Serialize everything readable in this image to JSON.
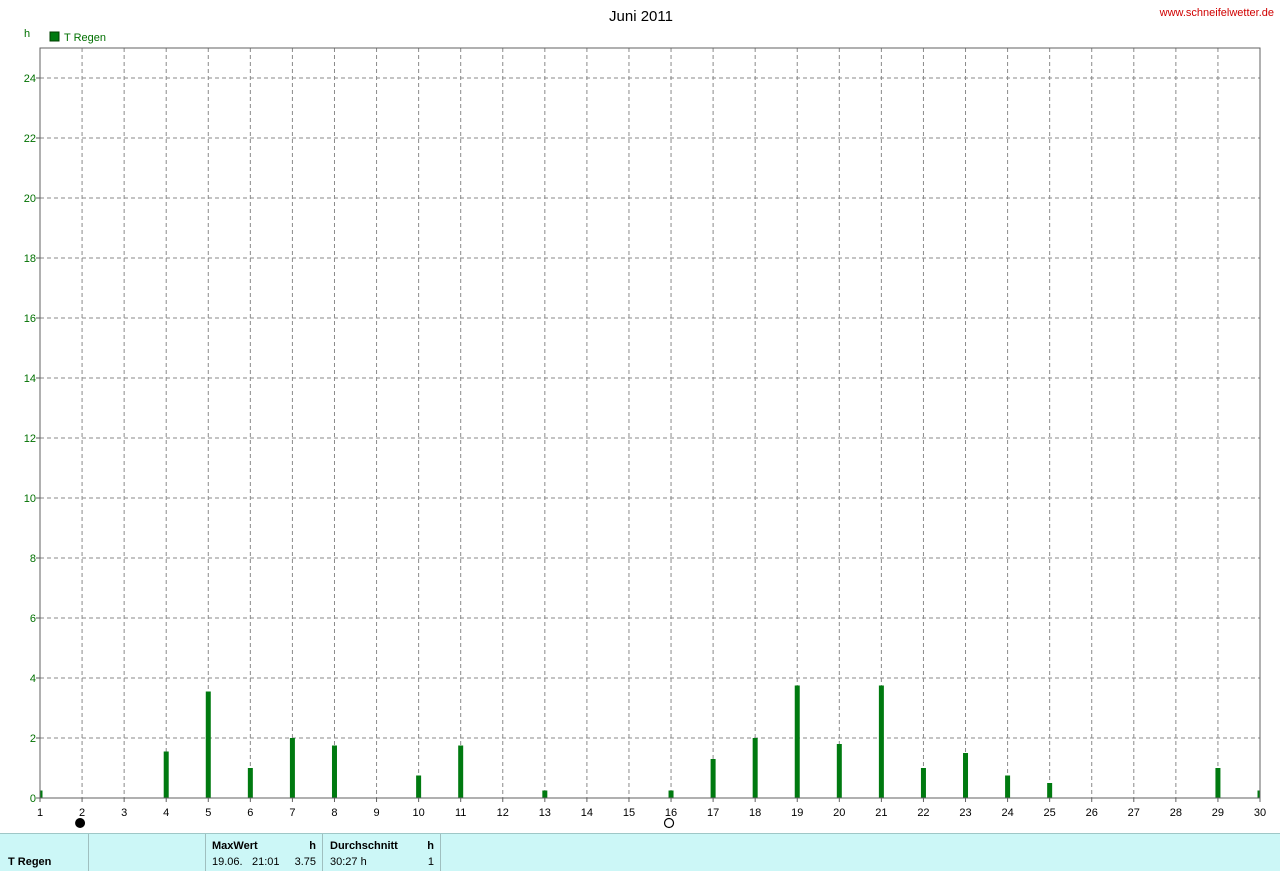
{
  "chart_data": {
    "type": "bar",
    "title": "Juni 2011",
    "ylabel": "h",
    "ylim": [
      0,
      25
    ],
    "yticks": [
      0,
      2,
      4,
      6,
      8,
      10,
      12,
      14,
      16,
      18,
      20,
      22,
      24
    ],
    "categories": [
      "1",
      "2",
      "3",
      "4",
      "5",
      "6",
      "7",
      "8",
      "9",
      "10",
      "11",
      "12",
      "13",
      "14",
      "15",
      "16",
      "17",
      "18",
      "19",
      "20",
      "21",
      "22",
      "23",
      "24",
      "25",
      "26",
      "27",
      "28",
      "29",
      "30"
    ],
    "series": [
      {
        "name": "T Regen",
        "color": "#007a10",
        "values": [
          0.25,
          0.0,
          0.0,
          1.55,
          3.55,
          1.0,
          2.0,
          1.75,
          0.0,
          0.75,
          1.75,
          0.0,
          0.25,
          0.0,
          0.0,
          0.25,
          1.3,
          2.0,
          3.75,
          1.8,
          3.75,
          1.0,
          1.5,
          0.75,
          0.5,
          0.0,
          0.0,
          0.0,
          1.0,
          0.25
        ]
      }
    ],
    "grid": true,
    "legend": "top-left",
    "moon_phases": [
      {
        "day": "2",
        "phase": "new-moon-icon"
      },
      {
        "day": "16",
        "phase": "full-moon-icon"
      }
    ]
  },
  "watermark": "www.schneifelwetter.de",
  "footer": {
    "series_name": "T Regen",
    "max_header": "MaxWert",
    "max_unit": "h",
    "max_date": "19.06.",
    "max_time": "21:01",
    "max_value": "3.75",
    "avg_header": "Durchschnitt",
    "avg_unit": "h",
    "avg_total": "30:27 h",
    "avg_value": "1"
  }
}
